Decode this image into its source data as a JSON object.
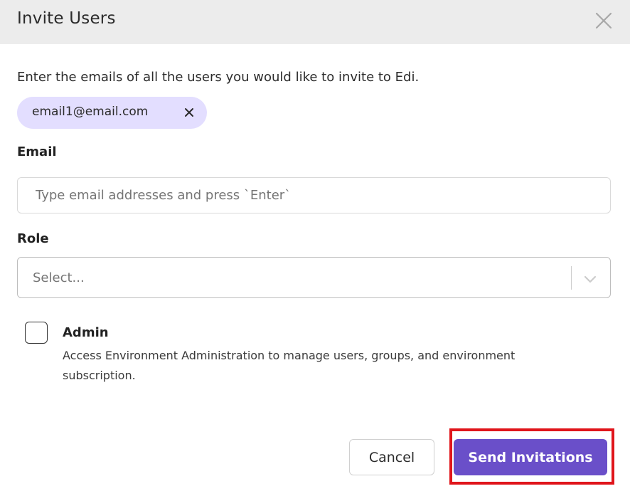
{
  "dialog": {
    "title": "Invite Users",
    "intro": "Enter the emails of all the users you would like to invite to Edi."
  },
  "chips": [
    {
      "label": "email1@email.com"
    }
  ],
  "email": {
    "label": "Email",
    "placeholder": "Type email addresses and press `Enter`",
    "value": ""
  },
  "role": {
    "label": "Role",
    "placeholder": "Select..."
  },
  "admin": {
    "title": "Admin",
    "description": "Access Environment Administration to manage users, groups, and environment subscription.",
    "checked": false
  },
  "actions": {
    "cancel_label": "Cancel",
    "send_label": "Send Invitations"
  },
  "colors": {
    "accent": "#6a4fc9",
    "chip_bg": "#e3deff",
    "highlight": "#e0151b",
    "header_bg": "#ececec"
  },
  "icons": {
    "close": "close-icon",
    "chip_remove": "close-icon",
    "dropdown": "chevron-down-icon"
  }
}
